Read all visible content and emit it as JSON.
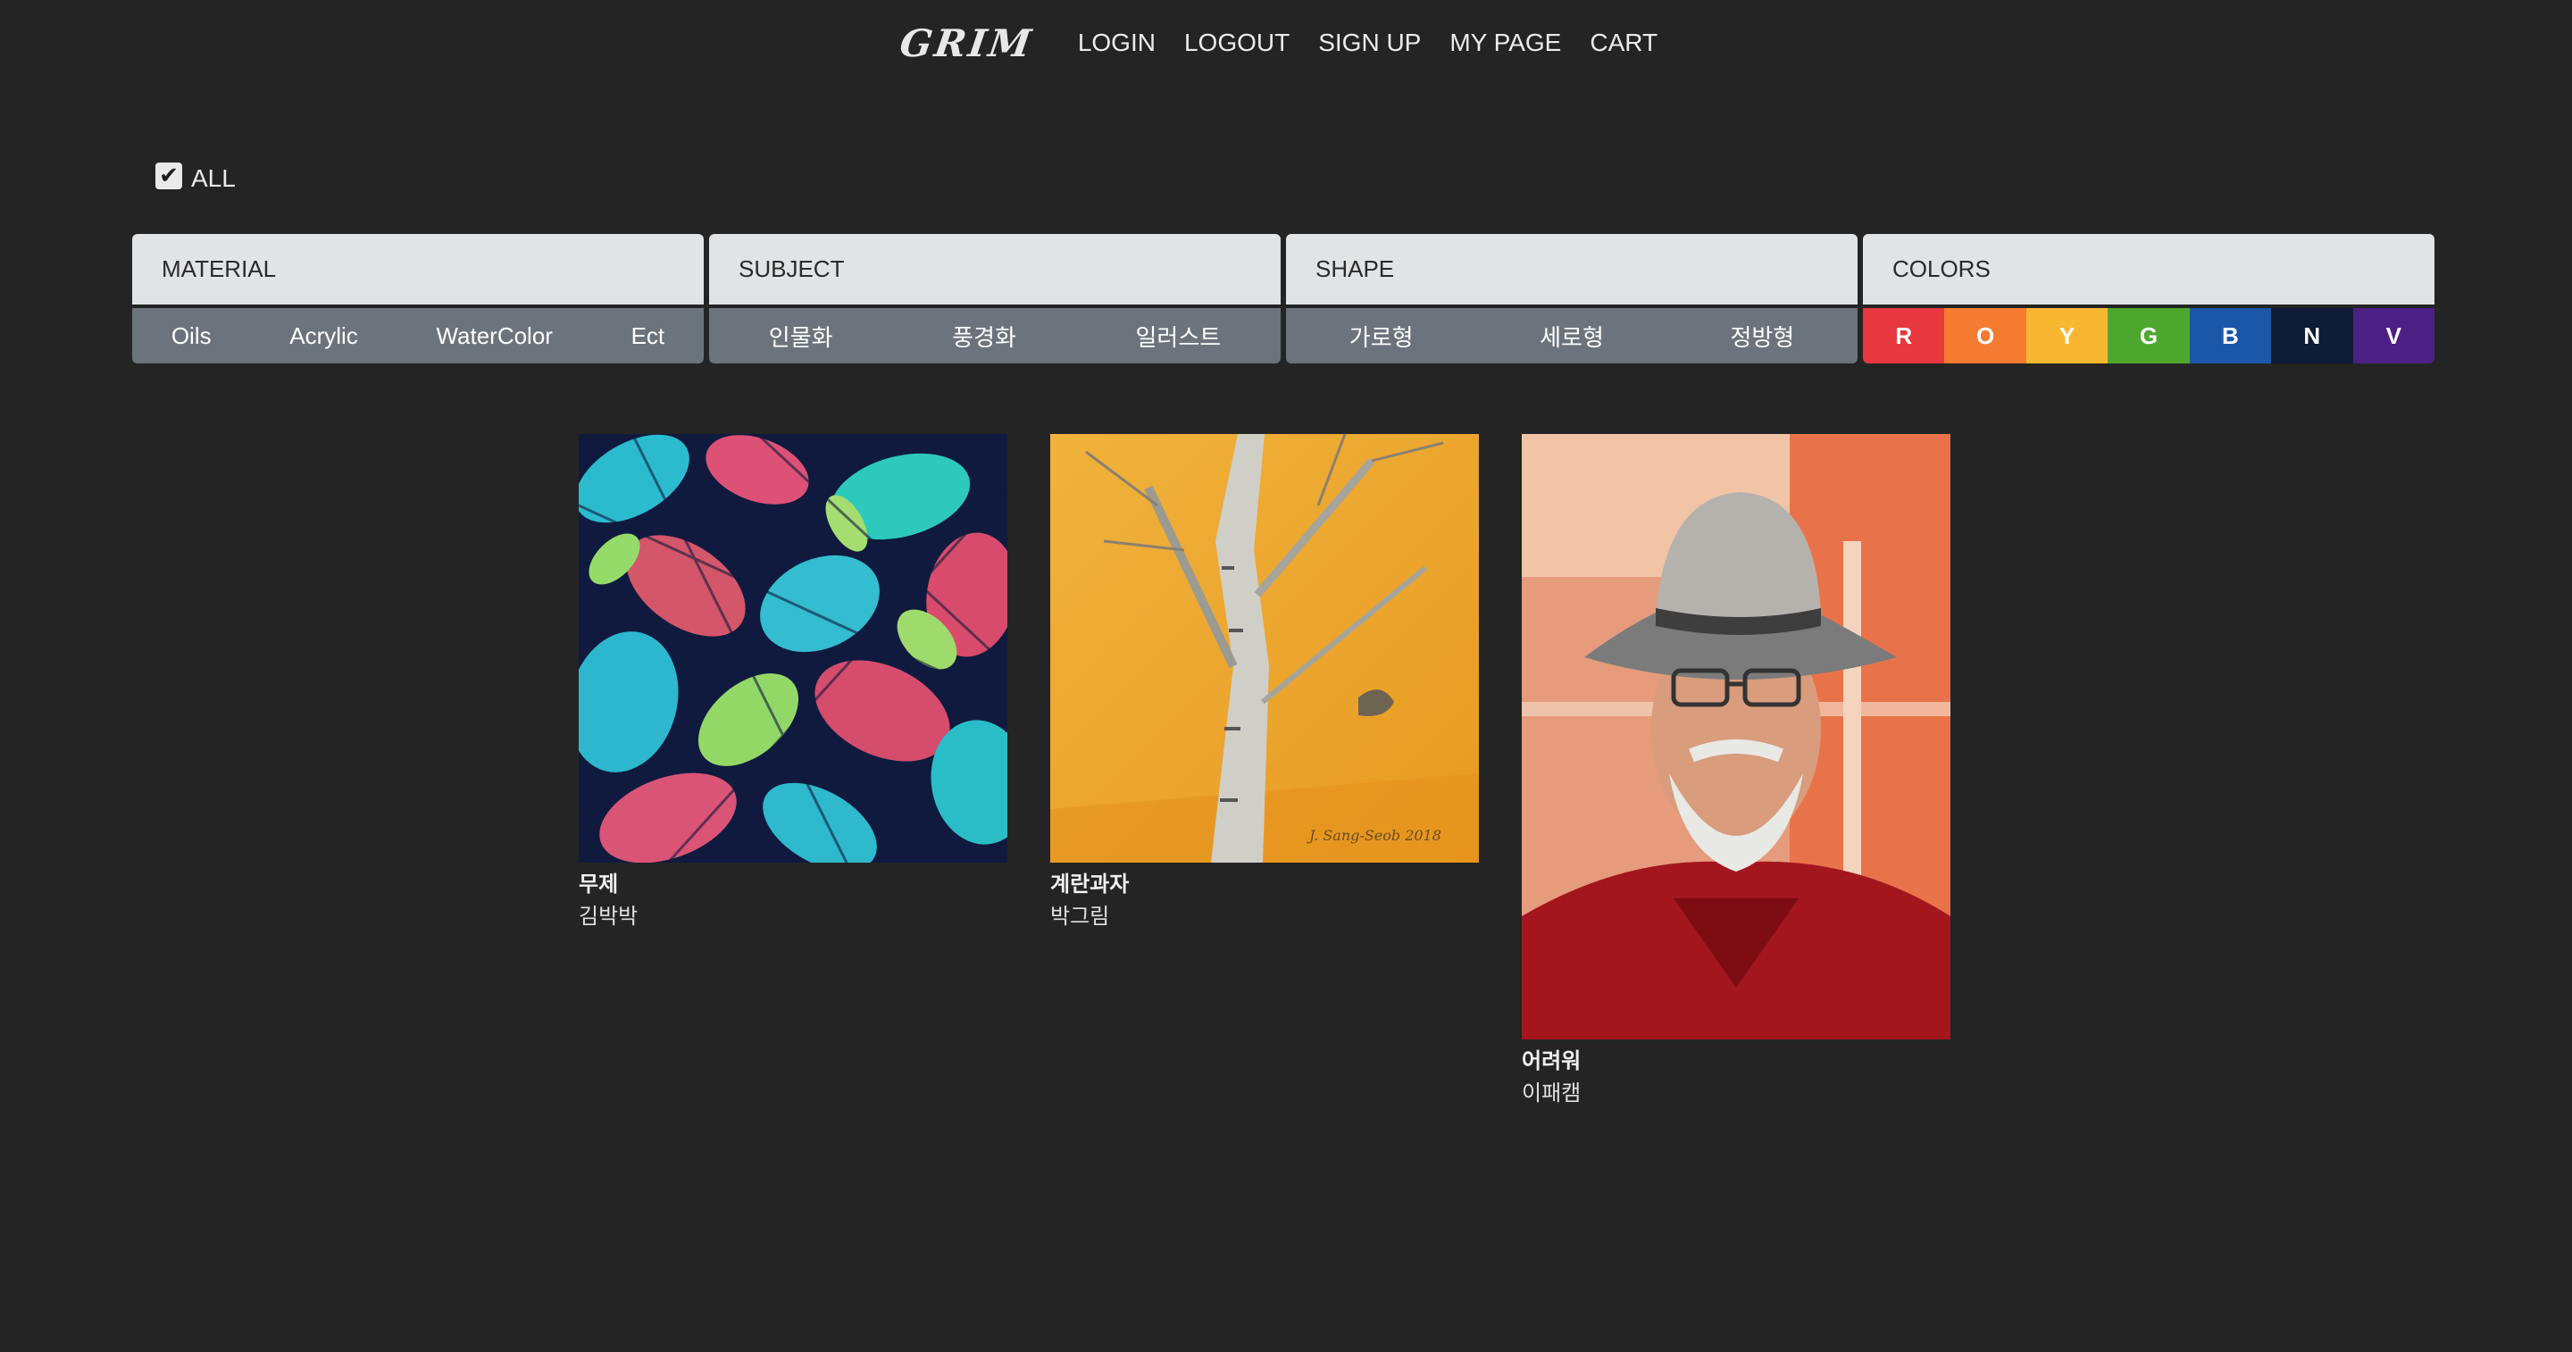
{
  "nav": {
    "logo": "GRIM",
    "links": [
      "LOGIN",
      "LOGOUT",
      "SIGN UP",
      "MY PAGE",
      "CART"
    ]
  },
  "filter_all": {
    "label": "ALL",
    "checked": true
  },
  "filters": {
    "material": {
      "title": "MATERIAL",
      "options": [
        "Oils",
        "Acrylic",
        "WaterColor",
        "Ect"
      ]
    },
    "subject": {
      "title": "SUBJECT",
      "options": [
        "인물화",
        "풍경화",
        "일러스트"
      ]
    },
    "shape": {
      "title": "SHAPE",
      "options": [
        "가로형",
        "세로형",
        "정방형"
      ]
    },
    "colors": {
      "title": "COLORS",
      "options": [
        {
          "label": "R",
          "color": "#e8383f"
        },
        {
          "label": "O",
          "color": "#f47b30"
        },
        {
          "label": "Y",
          "color": "#f7b731"
        },
        {
          "label": "G",
          "color": "#4ea72e"
        },
        {
          "label": "B",
          "color": "#1b57a8"
        },
        {
          "label": "N",
          "color": "#0d1b36"
        },
        {
          "label": "V",
          "color": "#4c1f84"
        }
      ]
    }
  },
  "artworks": [
    {
      "title": "무제",
      "artist": "김박박",
      "image": "tropical-leaf-pattern"
    },
    {
      "title": "계란과자",
      "artist": "박그림",
      "image": "birch-tree-on-yellow"
    },
    {
      "title": "어려워",
      "artist": "이패캠",
      "image": "portrait-man-in-hat"
    }
  ]
}
